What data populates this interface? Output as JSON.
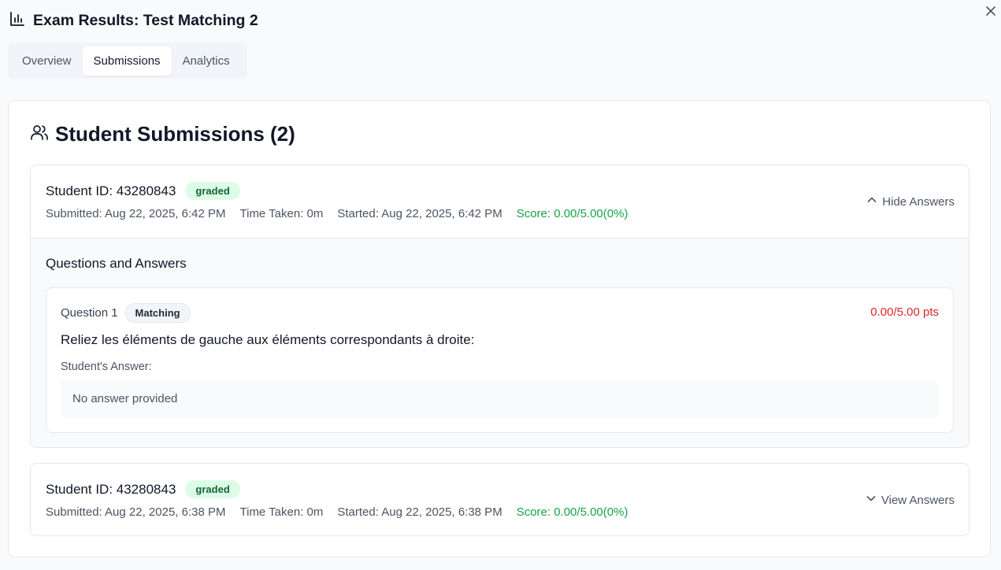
{
  "dialog": {
    "title": "Exam Results: Test Matching 2",
    "close_icon": "close-icon",
    "title_icon": "bar-chart-icon"
  },
  "tabs": [
    {
      "label": "Overview",
      "active": false
    },
    {
      "label": "Submissions",
      "active": true
    },
    {
      "label": "Analytics",
      "active": false
    }
  ],
  "submissions_panel": {
    "title": "Student Submissions (2)",
    "icon": "users-icon",
    "submissions": [
      {
        "student_id": "Student ID: 43280843",
        "status": "graded",
        "submitted": "Submitted: Aug 22, 2025, 6:42 PM",
        "time_taken": "Time Taken: 0m",
        "started": "Started: Aug 22, 2025, 6:42 PM",
        "score": "Score: 0.00/5.00(0%)",
        "toggle_label": "Hide Answers",
        "expanded": true,
        "qa": {
          "title": "Questions and Answers",
          "questions": [
            {
              "number": "Question 1",
              "type": "Matching",
              "points": "0.00/5.00 pts",
              "text": "Reliez les éléments de gauche aux éléments correspondants à droite:",
              "answer_label": "Student's Answer:",
              "answer": "No answer provided"
            }
          ]
        }
      },
      {
        "student_id": "Student ID: 43280843",
        "status": "graded",
        "submitted": "Submitted: Aug 22, 2025, 6:38 PM",
        "time_taken": "Time Taken: 0m",
        "started": "Started: Aug 22, 2025, 6:38 PM",
        "score": "Score: 0.00/5.00(0%)",
        "toggle_label": "View Answers",
        "expanded": false
      }
    ]
  },
  "colors": {
    "score_green": "#16a34a",
    "points_red": "#dc2626",
    "badge_green_bg": "#dcfce7",
    "badge_green_text": "#166534"
  }
}
